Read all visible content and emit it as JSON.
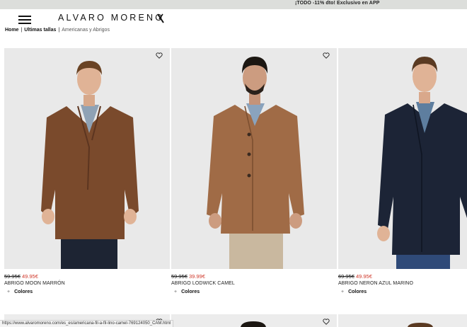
{
  "promo": {
    "text": "¡TODO -11% dto! Exclusivo en APP"
  },
  "header": {
    "logo": "ALVARO MORENO"
  },
  "breadcrumb": {
    "items": [
      {
        "label": "Home"
      },
      {
        "label": "Ultimas tallas"
      },
      {
        "label": "Americanas y Abrigos"
      }
    ],
    "separator": "|"
  },
  "products": [
    {
      "old_price": "59.95€",
      "new_price": "49.95€",
      "name": "ABRIGO MOON MARRÓN",
      "colors_label": "Colores",
      "coat_color": "#7a4a2c",
      "inner_color": "#8fa2b5"
    },
    {
      "old_price": "59.95€",
      "new_price": "39.99€",
      "name": "ABRIGO LODWICK CAMEL",
      "colors_label": "Colores",
      "coat_color": "#a06b46",
      "inner_color": "#8aa3bd"
    },
    {
      "old_price": "69.95€",
      "new_price": "49.95€",
      "name": "ABRIGO NERON AZUL MARINO",
      "colors_label": "Colores",
      "coat_color": "#1c2436",
      "inner_color": "#5e7e9f"
    }
  ],
  "status_bar": {
    "url": "https://www.alvaromoreno.com/es_es/americana-fil-a-fil-lino-camel-769124050_CAM.html"
  },
  "colors": {
    "sale": "#d0392b",
    "promo_bg": "#dcdedb",
    "image_bg": "#e9e9e9"
  }
}
